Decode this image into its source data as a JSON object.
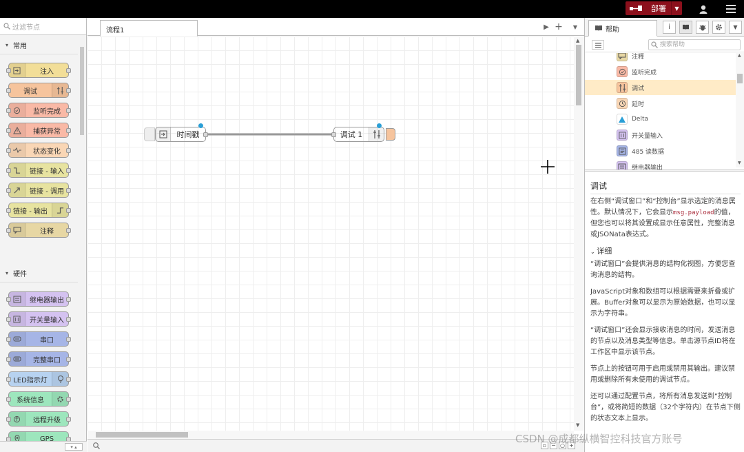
{
  "header": {
    "deploy_label": "部署",
    "colors": {
      "bar": "#000000",
      "deploy": "#8c101c"
    }
  },
  "palette": {
    "search_placeholder": "过滤节点",
    "categories": [
      {
        "label": "常用"
      },
      {
        "label": "硬件"
      }
    ],
    "common_nodes": [
      {
        "label": "注入",
        "color": "#f2de98",
        "icon": "inject-icon",
        "icon_side": "left"
      },
      {
        "label": "调试",
        "color": "#f6c49d",
        "icon": "debug-icon",
        "icon_side": "right"
      },
      {
        "label": "监听完成",
        "color": "#f9b9a6",
        "icon": "complete-icon",
        "icon_side": "left"
      },
      {
        "label": "捕获异常",
        "color": "#f9b9a6",
        "icon": "warning-icon",
        "icon_side": "left"
      },
      {
        "label": "状态变化",
        "color": "#f9d6b5",
        "icon": "status-icon",
        "icon_side": "left"
      },
      {
        "label": "链接 - 输入",
        "color": "#e7e3a0",
        "icon": "link-in-icon",
        "icon_side": "left"
      },
      {
        "label": "链接 - 调用",
        "color": "#e7e3a0",
        "icon": "link-call-icon",
        "icon_side": "left"
      },
      {
        "label": "链接 - 输出",
        "color": "#e7e3a0",
        "icon": "link-out-icon",
        "icon_side": "right"
      },
      {
        "label": "注释",
        "color": "#e7d7a4",
        "icon": "comment-icon",
        "icon_side": "left"
      }
    ],
    "hardware_nodes": [
      {
        "label": "继电器输出",
        "color": "#d4c2f0",
        "icon": "relay-icon",
        "icon_side": "left"
      },
      {
        "label": "开关量输入",
        "color": "#d4c2f0",
        "icon": "digital-in-icon",
        "icon_side": "left"
      },
      {
        "label": "串口",
        "color": "#a6b5e6",
        "icon": "serial-icon",
        "icon_side": "left"
      },
      {
        "label": "完整串口",
        "color": "#a6b5e6",
        "icon": "serial-full-icon",
        "icon_side": "left"
      },
      {
        "label": "LED指示灯",
        "color": "#b7d2f0",
        "icon": "led-icon",
        "icon_side": "right"
      },
      {
        "label": "系统信息",
        "color": "#9de6bd",
        "icon": "gear-icon",
        "icon_side": "right"
      },
      {
        "label": "远程升级",
        "color": "#9de6bd",
        "icon": "upgrade-icon",
        "icon_side": "left"
      },
      {
        "label": "GPS",
        "color": "#9de6bd",
        "icon": "gps-icon",
        "icon_side": "left"
      }
    ]
  },
  "workspace": {
    "tab_label": "流程1",
    "flow_nodes": [
      {
        "label": "时间戳",
        "color": "#f2de98"
      },
      {
        "label": "调试 1",
        "color": "#f6c49d"
      }
    ]
  },
  "sidebar": {
    "tab_label": "帮助",
    "search_placeholder": "搜索帮助",
    "help_list": [
      {
        "label": "注释",
        "color": "#e7d7a4",
        "icon": "comment-icon"
      },
      {
        "label": "监听完成",
        "color": "#f9b9a6",
        "icon": "complete-icon"
      },
      {
        "label": "调试",
        "color": "#f6c49d",
        "icon": "debug-icon"
      },
      {
        "label": "延时",
        "color": "#f9d6b5",
        "icon": "clock-icon"
      },
      {
        "label": "Delta",
        "color": "#ffffff",
        "icon": "delta-icon"
      },
      {
        "label": "开关量输入",
        "color": "#d4c2f0",
        "icon": "digital-in-icon"
      },
      {
        "label": "485 读数据",
        "color": "#a6b5e6",
        "icon": "rs485-icon"
      },
      {
        "label": "继电器输出",
        "color": "#d4c2f0",
        "icon": "relay-icon"
      }
    ],
    "help": {
      "title": "调试",
      "p1_a": "在右侧“调试窗口”和“控制台”显示选定的消息属性。默认情况下，它会显示",
      "p1_code": "msg.payload",
      "p1_b": "的值，但您也可以将其设置成显示任意属性，完整消息或JSONata表达式。",
      "details_label": "详细",
      "p2": "“调试窗口”会提供消息的结构化视图，方便您查询消息的结构。",
      "p3": "JavaScript对象和数组可以根据需要来折叠或扩展。Buffer对象可以显示为原始数据，也可以显示为字符串。",
      "p4": "“调试窗口”还会显示接收消息的时间，发送消息的节点以及消息类型等信息。单击源节点ID将在工作区中显示该节点。",
      "p5": "节点上的按钮可用于启用或禁用其输出。建议禁用或删除所有未使用的调试节点。",
      "p6": "还可以通过配置节点，将所有消息发送到“控制台”，或将简短的数据（32个字符内）在节点下侧的状态文本上显示。"
    }
  },
  "watermark": "CSDN @成都纵横智控科技官方账号"
}
